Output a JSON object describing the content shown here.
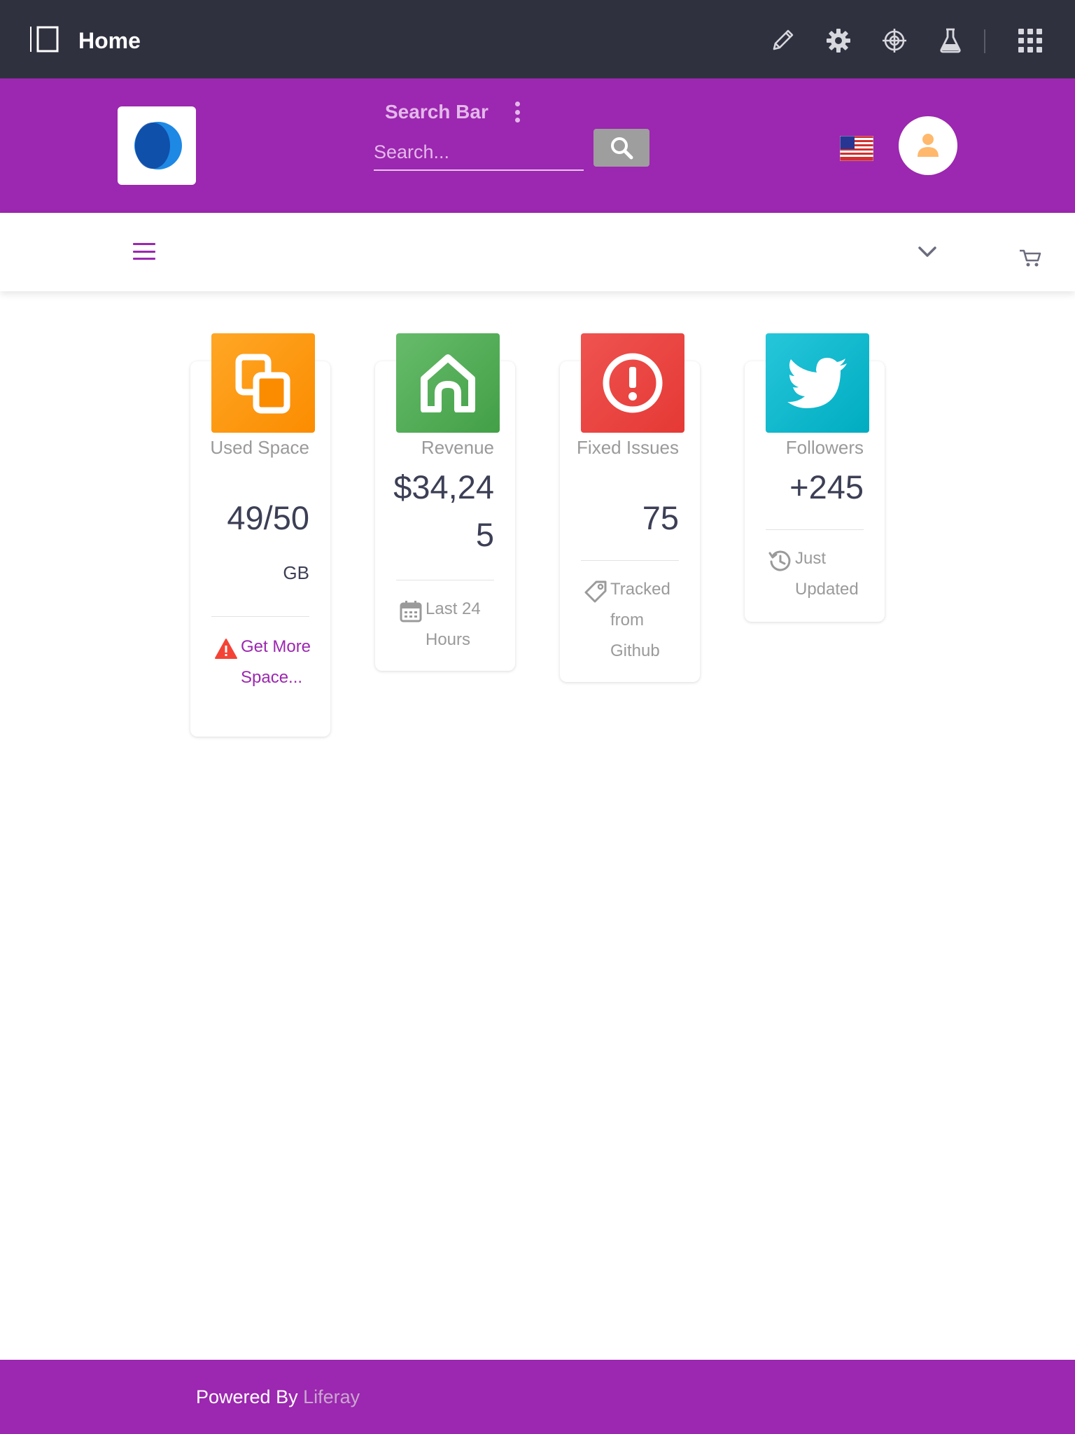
{
  "control_menu": {
    "title": "Home",
    "icons": [
      "sidebar-toggle-icon",
      "pencil-icon",
      "gear-icon",
      "simulation-icon",
      "flask-icon",
      "apps-grid-icon"
    ]
  },
  "header": {
    "search_title": "Search Bar",
    "search_placeholder": "Search...",
    "accent_color": "#9c27b0"
  },
  "cards": [
    {
      "label": "Used Space",
      "value": "49/50",
      "unit": "GB",
      "footer": "Get More Space...",
      "icon": "copy-icon",
      "footer_icon": "warning-icon",
      "color": "#fb8c00"
    },
    {
      "label": "Revenue",
      "value": "$34,245",
      "footer": "Last 24 Hours",
      "icon": "home-icon",
      "footer_icon": "calendar-icon",
      "color": "#43a047"
    },
    {
      "label": "Fixed Issues",
      "value": "75",
      "footer": "Tracked from Github",
      "icon": "info-icon",
      "footer_icon": "tag-icon",
      "color": "#e53935"
    },
    {
      "label": "Followers",
      "value": "+245",
      "footer": "Just Updated",
      "icon": "twitter-icon",
      "footer_icon": "history-icon",
      "color": "#00acc1"
    }
  ],
  "footer": {
    "powered_by": "Powered By",
    "brand": "Liferay"
  }
}
